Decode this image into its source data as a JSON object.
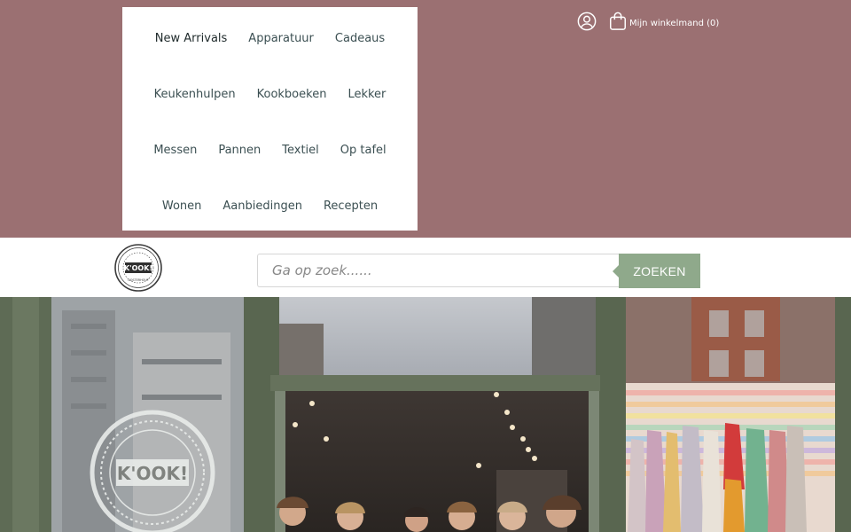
{
  "nav": {
    "rows": [
      [
        "New Arrivals",
        "Apparatuur",
        "Cadeaus"
      ],
      [
        "Keukenhulpen",
        "Kookboeken",
        "Lekker"
      ],
      [
        "Messen",
        "Pannen",
        "Textiel",
        "Op tafel"
      ],
      [
        "Wonen",
        "Aanbiedingen",
        "Recepten"
      ]
    ]
  },
  "account": {
    "icon": "user-circle-icon"
  },
  "cart": {
    "icon": "shopping-bag-icon",
    "label": "Mijn winkelmand (0)"
  },
  "logo": {
    "text": "K'OOK!",
    "ring_text": "OOSTERHOUT",
    "icon": "kook-logo"
  },
  "search": {
    "placeholder": "Ga op zoek......",
    "button_label": "ZOEKEN"
  },
  "hero": {
    "window_logo": "K'OOK!",
    "icon": "storefront-photo"
  },
  "colors": {
    "topbar": "#9b7072",
    "accent": "#8fa98b",
    "nav_text": "#3b4f52"
  }
}
